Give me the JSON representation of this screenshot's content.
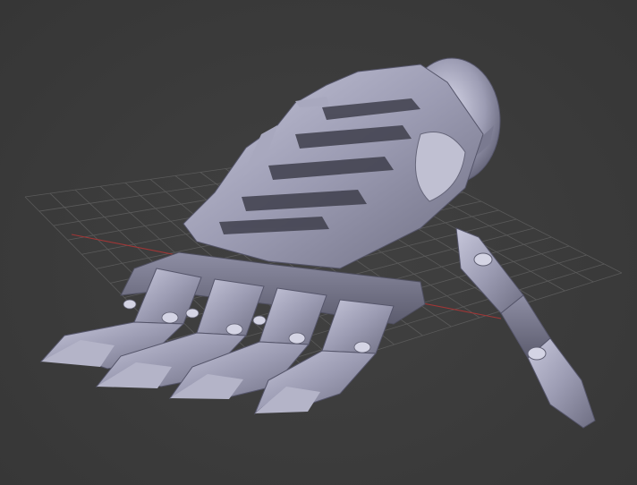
{
  "viewport": {
    "kind": "3d-viewport",
    "background_color": "#3b3b3b",
    "grid_color": "#5a5a5a",
    "x_axis_color": "#b03a3a",
    "y_axis_color": "#5a9a5a",
    "model_color": "#9a9ab0",
    "model_name": "robotic-hand-model",
    "grid_visible": true
  }
}
